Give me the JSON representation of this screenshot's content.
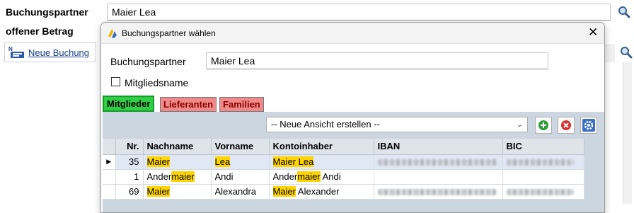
{
  "main": {
    "partner_label": "Buchungspartner",
    "partner_value": "Maier Lea",
    "open_amount_label": "offener Betrag",
    "new_booking_label": "Neue Buchung"
  },
  "dialog": {
    "title": "Buchungspartner wählen",
    "partner_label": "Buchungspartner",
    "partner_value": "Maier Lea",
    "member_name_label": "Mitgliedsname",
    "tabs": [
      {
        "label": "Mitglieder",
        "color": "#2fcf45"
      },
      {
        "label": "Lieferanten",
        "color": "#f08a8a"
      },
      {
        "label": "Familien",
        "color": "#f08a8a"
      }
    ],
    "view_combo": "-- Neue Ansicht erstellen --",
    "columns": [
      "Nr.",
      "Nachname",
      "Vorname",
      "Kontoinhaber",
      "IBAN",
      "BIC"
    ],
    "rows": [
      {
        "nr": "35",
        "nachname_hl": "Maier",
        "nachname_rest": "",
        "nachname_pre": "",
        "vorname_hl": "Lea",
        "vorname": "",
        "konto_hl": "Maier",
        "konto_pre": "",
        "konto_rest": " Lea",
        "konto_rest_hl": true
      },
      {
        "nr": "1",
        "nachname_pre": "Ander",
        "nachname_hl": "maier",
        "nachname_rest": "",
        "vorname_hl": "",
        "vorname": "Andi",
        "konto_pre": "Ander",
        "konto_hl": "maier",
        "konto_rest": " Andi",
        "konto_rest_hl": false
      },
      {
        "nr": "69",
        "nachname_pre": "",
        "nachname_hl": "Maier",
        "nachname_rest": "",
        "vorname_hl": "",
        "vorname": "Alexandra",
        "konto_pre": "",
        "konto_hl": "Maier",
        "konto_rest": " Alexander",
        "konto_rest_hl": false
      }
    ]
  },
  "colors": {
    "highlight": "#ffd400",
    "add_button": "#2e9e3a",
    "delete_button": "#d9302e",
    "settings_button": "#3a6fc4"
  }
}
